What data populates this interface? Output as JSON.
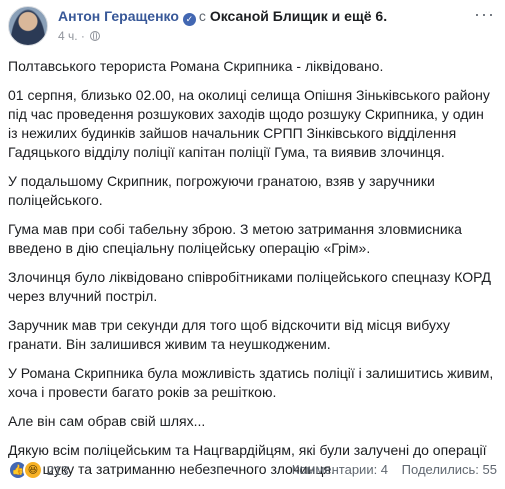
{
  "post": {
    "author": "Антон Геращенко",
    "with_prefix": "с",
    "tagged_person": "Оксаной Блищик",
    "tagged_more": "и ещё 6.",
    "time": "4 ч.",
    "privacy_icon": "globe-icon",
    "verified_icon": "verified-check-icon",
    "more_icon": "more-options-icon",
    "paragraphs": [
      "Полтавського терориста Романа Скрипника - ліквідовано.",
      "01 серпня, близько 02.00, на околиці селища Опішня Зіньківського району під час проведення розшукових заходів щодо розшуку Скрипника, у один із нежилих будинків зайшов начальник СРПП Зінківського відділення Гадяцького відділу поліції капітан поліції Гума, та виявив злочинця.",
      "У подальшому Скрипник, погрожуючи гранатою, взяв у заручники поліцейського.",
      "Гума мав при собі табельну зброю. З метою затримання зловмисника введено в дію спеціальну поліцейську операцію «Грім».",
      "Злочинця було ліквідовано співробітниками поліцейського спецназу КОРД через влучний постріл.",
      "Заручник мав три секунди для того щоб відскочити від місця вибуху гранати. Він залишився живим та неушкодженим.",
      "У Романа Скрипника була можливість здатись поліції і залишитись живим, хоча і провести багато років за решіткою.",
      "Але він сам обрав свій шлях...",
      "Дякую всім поліцейським та Нацгвардійцям, які були залучені до операції по пошуку та затриманню небезпечного злочинця."
    ]
  },
  "footer": {
    "reaction_icons": [
      "like-icon",
      "haha-icon"
    ],
    "reaction_count": "213",
    "comments": "Комментарии: 4",
    "shares": "Поделились: 55"
  },
  "colors": {
    "author_link": "#385898",
    "verified_badge": "#4267b2",
    "secondary_text": "#606770"
  }
}
